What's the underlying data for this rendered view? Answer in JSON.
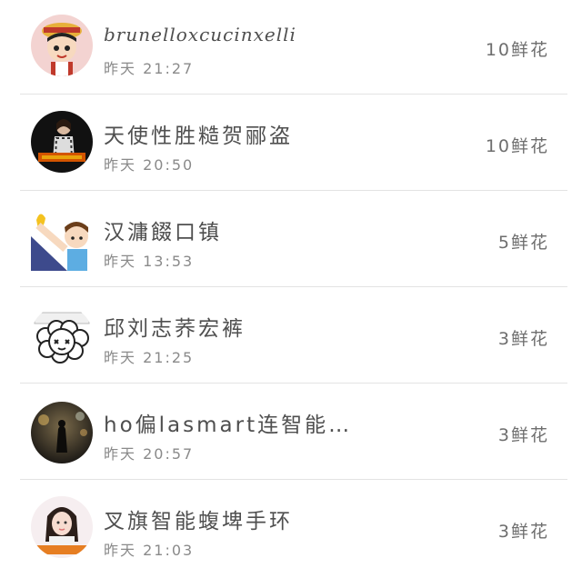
{
  "list": [
    {
      "name": "brunelloxcucinxelli",
      "time": "昨天 21:27",
      "flowers": "10鲜花",
      "avatar_icon": "cartoon-girl-avatar-icon"
    },
    {
      "name": "天使性胜糙贺郦盗",
      "time": "昨天 20:50",
      "flowers": "10鲜花",
      "avatar_icon": "woman-photo-avatar-icon"
    },
    {
      "name": "汉滽餟口镇",
      "time": "昨天 13:53",
      "flowers": "5鲜花",
      "avatar_icon": "cartoon-boy-avatar-icon"
    },
    {
      "name": "邱刘志荞宏裤",
      "time": "昨天 21:25",
      "flowers": "3鲜花",
      "avatar_icon": "cartoon-sheep-avatar-icon"
    },
    {
      "name": "ho偏lasmart连智能…",
      "time": "昨天 20:57",
      "flowers": "3鲜花",
      "avatar_icon": "night-photo-avatar-icon"
    },
    {
      "name": "叉旗智能蝮埤手环",
      "time": "昨天 21:03",
      "flowers": "3鲜花",
      "avatar_icon": "girl-photo-avatar-icon"
    }
  ]
}
